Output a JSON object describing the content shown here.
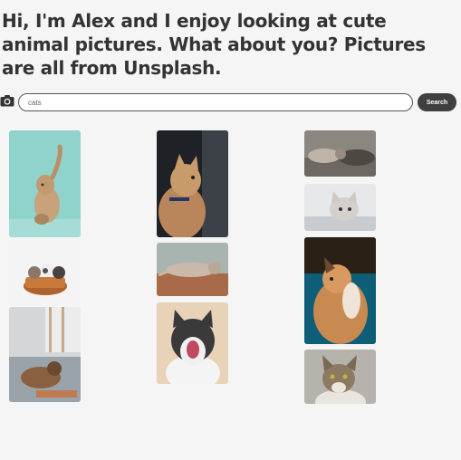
{
  "page": {
    "heading": "Hi, I'm Alex and I enjoy looking at cute animal pictures. What about you? Pictures are all from Unsplash."
  },
  "search": {
    "icon": "camera-icon",
    "value": "cats",
    "button_label": "Search"
  },
  "gallery": {
    "columns": [
      [
        "kitten-reaching-up",
        "kittens-in-basket",
        "cats-lying-on-blanket"
      ],
      [
        "cat-side-portrait",
        "cat-stretching-on-floor",
        "cat-yawning"
      ],
      [
        "cats-lying-down",
        "kitten-white-backdrop",
        "cat-looking-up-teal",
        "tabby-cat-portrait"
      ]
    ]
  }
}
